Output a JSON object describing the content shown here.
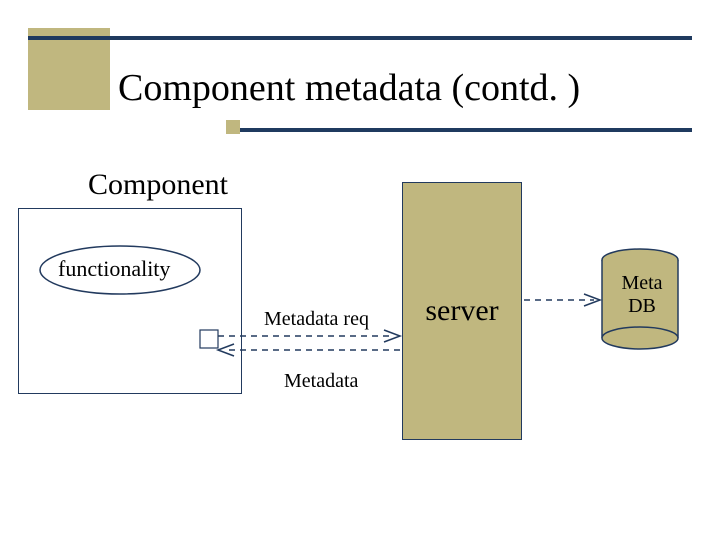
{
  "slide": {
    "title": "Component metadata (contd. )"
  },
  "labels": {
    "component": "Component",
    "functionality": "functionality",
    "server": "server",
    "meta_db_line1": "Meta",
    "meta_db_line2": "DB",
    "metadata_req": "Metadata req",
    "metadata": "Metadata"
  },
  "colors": {
    "accent": "#c0b77f",
    "dark": "#1f3a5f",
    "stroke": "#223a5e"
  }
}
